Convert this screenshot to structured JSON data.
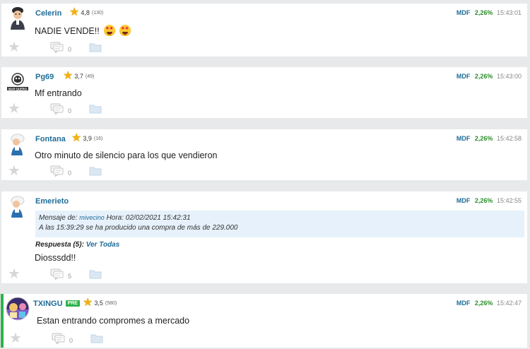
{
  "posts": [
    {
      "user": "Celerin",
      "rating": "4,8",
      "votes": "(130)",
      "ticker": "MDF",
      "change": "2,26%",
      "time": "15:43:01",
      "text": "NADIE VENDE!!",
      "comments": "0",
      "avatar": "cartoon-avatar-icon"
    },
    {
      "user": "Pg69",
      "rating": "3,7",
      "votes": "(49)",
      "ticker": "MDF",
      "change": "2,26%",
      "time": "15:43:00",
      "text": "Mf entrando",
      "comments": "0",
      "avatar": "logo-avatar-icon"
    },
    {
      "user": "Fontana",
      "rating": "3,9",
      "votes": "(16)",
      "ticker": "MDF",
      "change": "2,26%",
      "time": "15:42:58",
      "text": "Otro minuto de silencio para los que vendieron",
      "comments": "0",
      "avatar": "default-user-icon"
    },
    {
      "user": "Emerieto",
      "ticker": "MDF",
      "change": "2,26%",
      "time": "15:42:55",
      "quote_prefix": "Mensaje de:",
      "quote_user": "mivecino",
      "quote_time": "Hora: 02/02/2021 15:42:31",
      "quote_text": "A las 15:39:29  se ha producido una compra de más de 229.000",
      "reply_label": "Respuesta (5):",
      "reply_link": "Ver Todas",
      "text": "Diosssdd!!",
      "comments": "5",
      "avatar": "default-user-icon"
    },
    {
      "user": "TXINGU",
      "badge": "PRE",
      "rating": "3,5",
      "votes": "(580)",
      "ticker": "MDF",
      "change": "2,26%",
      "time": "15:42:47",
      "text": "Estan entrando compromes a mercado",
      "comments": "0",
      "avatar": "photo-avatar-icon"
    }
  ],
  "colors": {
    "username": "#1f6d97",
    "change_positive": "#2a8f2a",
    "pre_badge": "#2db34a",
    "quote_bg": "#e6f1fb"
  }
}
